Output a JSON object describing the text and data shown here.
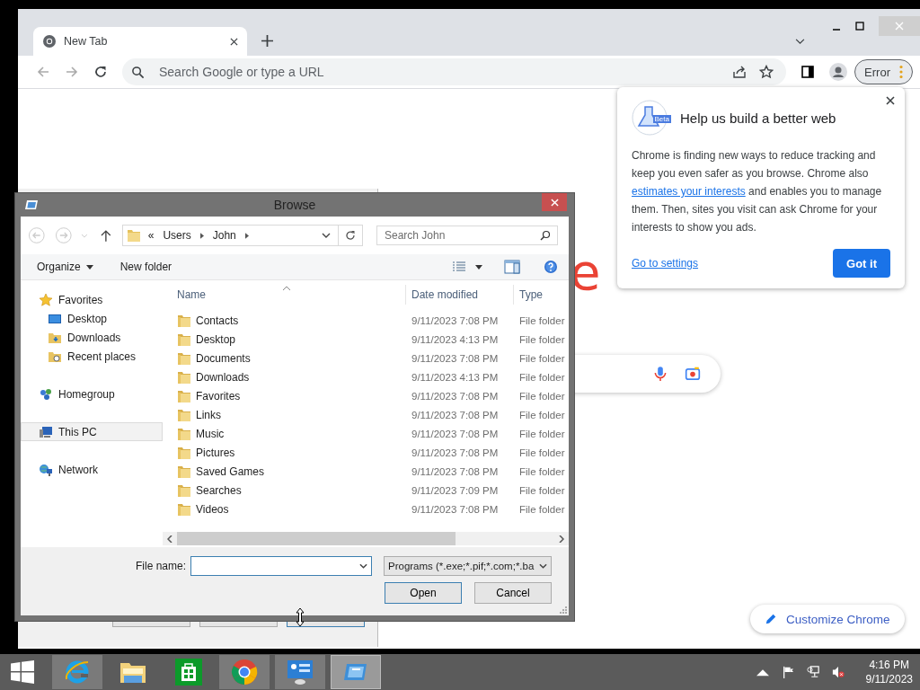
{
  "browser": {
    "tabs": [
      {
        "title": "New Tab",
        "selected": true
      }
    ],
    "omnibox": {
      "placeholder": "Search Google or type a URL"
    },
    "profile_button": "Error",
    "logo_fragment": "e",
    "popup": {
      "title": "Help us build a better web",
      "badge": "Beta",
      "text_before": "Chrome is finding new ways to reduce tracking and keep you even safer as you browse. Chrome also",
      "link": "estimates your interests",
      "text_after": "and enables you to manage them. Then, sites you visit can ask Chrome for your interests to show you ads.",
      "settings_link": "Go to settings",
      "button": "Got it"
    },
    "customize_button": "Customize Chrome"
  },
  "dialog": {
    "title": "Browse",
    "overflow_mark": "«",
    "breadcrumb": [
      "Users",
      "John"
    ],
    "search": {
      "placeholder": "Search John"
    },
    "commands": [
      {
        "label": "Organize",
        "dropdown": true
      },
      {
        "label": "New folder",
        "dropdown": false
      }
    ],
    "nav": [
      {
        "label": "Favorites",
        "kind": "favorites",
        "selected": false,
        "children": [
          {
            "label": "Desktop",
            "kind": "desktop",
            "selected": false
          },
          {
            "label": "Downloads",
            "kind": "downloads",
            "selected": false
          },
          {
            "label": "Recent places",
            "kind": "recent",
            "selected": false
          }
        ]
      },
      {
        "label": "Homegroup",
        "kind": "homegroup",
        "selected": false
      },
      {
        "label": "This PC",
        "kind": "pc",
        "selected": true
      },
      {
        "label": "Network",
        "kind": "network",
        "selected": false
      }
    ],
    "columns": [
      "Name",
      "Date modified",
      "Type"
    ],
    "files": [
      {
        "name": "Contacts",
        "date": "9/11/2023 7:08 PM",
        "type": "File folder"
      },
      {
        "name": "Desktop",
        "date": "9/11/2023 4:13 PM",
        "type": "File folder"
      },
      {
        "name": "Documents",
        "date": "9/11/2023 7:08 PM",
        "type": "File folder"
      },
      {
        "name": "Downloads",
        "date": "9/11/2023 4:13 PM",
        "type": "File folder"
      },
      {
        "name": "Favorites",
        "date": "9/11/2023 7:08 PM",
        "type": "File folder"
      },
      {
        "name": "Links",
        "date": "9/11/2023 7:08 PM",
        "type": "File folder"
      },
      {
        "name": "Music",
        "date": "9/11/2023 7:08 PM",
        "type": "File folder"
      },
      {
        "name": "Pictures",
        "date": "9/11/2023 7:08 PM",
        "type": "File folder"
      },
      {
        "name": "Saved Games",
        "date": "9/11/2023 7:08 PM",
        "type": "File folder"
      },
      {
        "name": "Searches",
        "date": "9/11/2023 7:09 PM",
        "type": "File folder"
      },
      {
        "name": "Videos",
        "date": "9/11/2023 7:08 PM",
        "type": "File folder"
      }
    ],
    "file_name_label": "File name:",
    "filter": "Programs (*.exe;*.pif;*.com;*.ba",
    "buttons": [
      {
        "label": "Open",
        "default": true
      },
      {
        "label": "Cancel",
        "default": false
      }
    ]
  },
  "taskbar": {
    "apps": [
      {
        "kind": "ie",
        "running": true,
        "active": false
      },
      {
        "kind": "explorer",
        "running": false,
        "active": false
      },
      {
        "kind": "store",
        "running": false,
        "active": false
      },
      {
        "kind": "chrome",
        "running": true,
        "active": false
      },
      {
        "kind": "control",
        "running": true,
        "active": false
      },
      {
        "kind": "dialog",
        "running": true,
        "active": true
      }
    ],
    "time": "4:16 PM",
    "date": "9/11/2023"
  }
}
